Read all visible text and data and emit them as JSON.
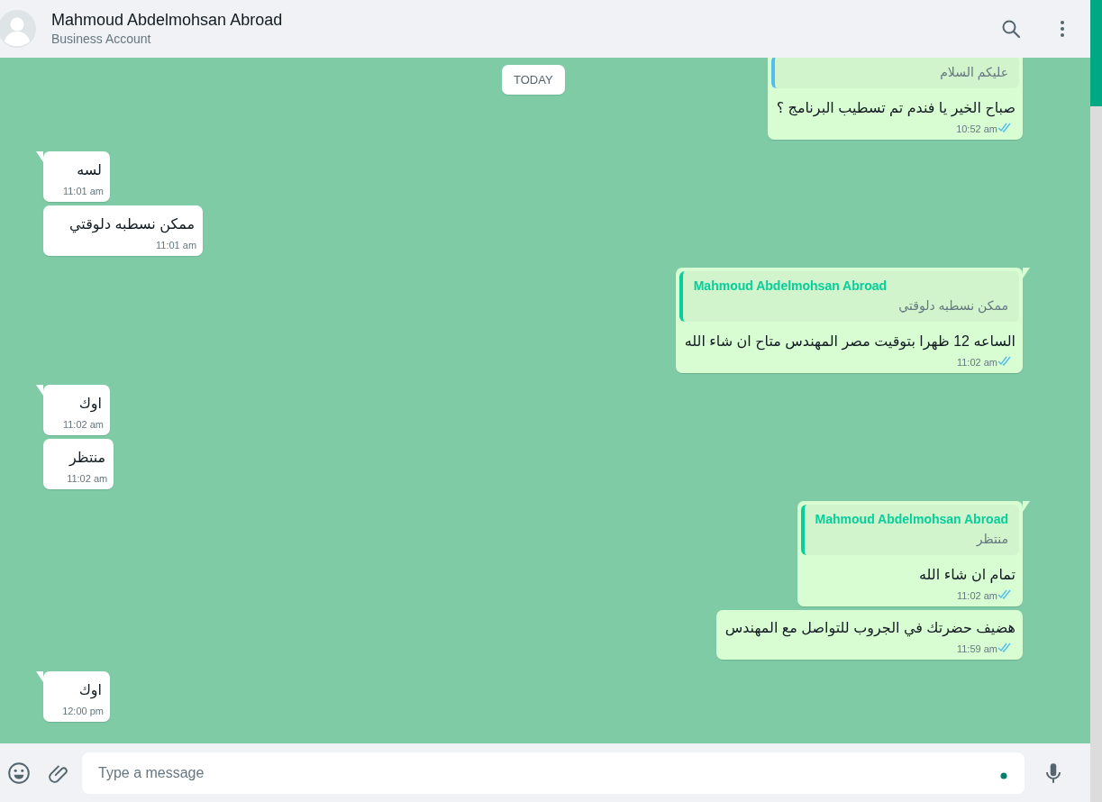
{
  "header": {
    "name": "Mahmoud Abdelmohsan Abroad",
    "subtitle": "Business Account"
  },
  "date_chip": "TODAY",
  "messages": [
    {
      "kind": "outgoing",
      "tail": false,
      "quote": {
        "text": "عليكم السلام",
        "color": "#53bdeb"
      },
      "text": "صباح الخير يا فندم تم تسطيب البرنامج ؟",
      "time": "10:52 am",
      "read": true
    },
    {
      "kind": "incoming",
      "tail": true,
      "text": "لسه",
      "time": "11:01 am"
    },
    {
      "kind": "incoming",
      "tail": false,
      "text": "ممكن نسطبه دلوقتي",
      "time": "11:01 am"
    },
    {
      "kind": "outgoing",
      "tail": true,
      "quote": {
        "sender": "Mahmoud Abdelmohsan Abroad",
        "text": "ممكن نسطبه دلوقتي",
        "color": "#06cf9c"
      },
      "text": "الساعه 12 ظهرا بتوقيت مصر المهندس متاح ان شاء الله",
      "time": "11:02 am",
      "read": true
    },
    {
      "kind": "incoming",
      "tail": true,
      "text": "اوك",
      "time": "11:02 am"
    },
    {
      "kind": "incoming",
      "tail": false,
      "text": "منتظر",
      "time": "11:02 am"
    },
    {
      "kind": "outgoing",
      "tail": true,
      "quote": {
        "sender": "Mahmoud Abdelmohsan Abroad",
        "text": "منتظر",
        "color": "#06cf9c"
      },
      "text": "تمام ان شاء الله",
      "time": "11:02 am",
      "read": true
    },
    {
      "kind": "outgoing",
      "tail": false,
      "text": "هضيف حضرتك في الجروب للتواصل مع المهندس",
      "time": "11:59 am",
      "read": true
    },
    {
      "kind": "incoming",
      "tail": true,
      "text": "اوك",
      "time": "12:00 pm"
    }
  ],
  "composer": {
    "placeholder": "Type a message"
  }
}
